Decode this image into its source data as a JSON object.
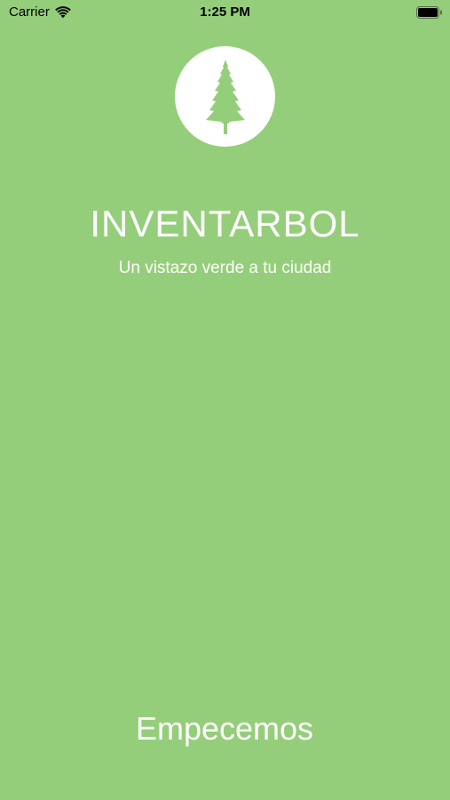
{
  "status_bar": {
    "carrier": "Carrier",
    "time": "1:25 PM"
  },
  "app": {
    "title": "INVENTARBOL",
    "subtitle": "Un vistazo verde a tu ciudad",
    "start_label": "Empecemos"
  },
  "icons": {
    "logo": "tree-icon",
    "wifi": "wifi-icon",
    "battery": "battery-icon"
  },
  "colors": {
    "background": "#95ce7a",
    "logo_circle": "#ffffff",
    "tree": "#95ce7a",
    "text": "#ffffff"
  }
}
